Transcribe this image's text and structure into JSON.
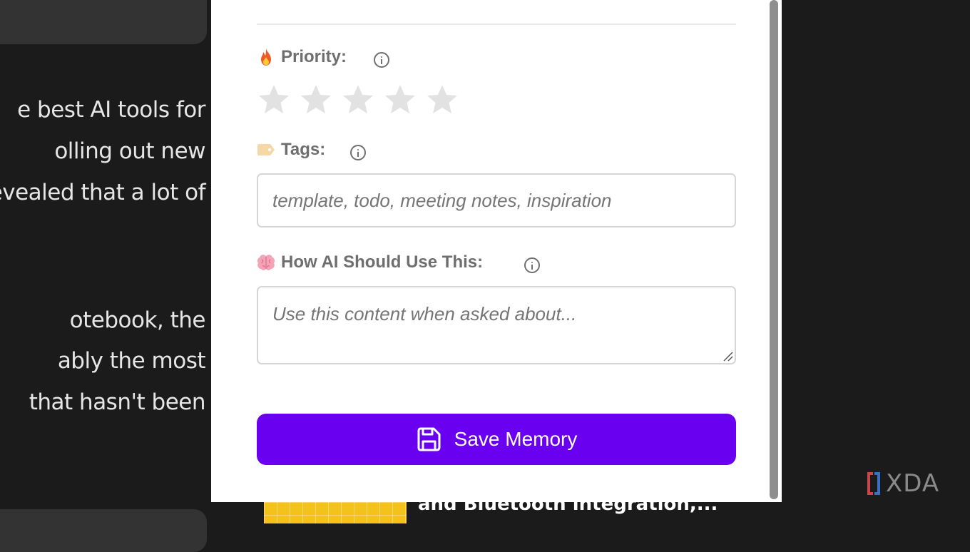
{
  "background_article": {
    "lines_top": [
      "e best AI tools for",
      "olling out new",
      "evealed that a lot of"
    ],
    "lines_bottom": [
      "otebook, the",
      "ably the most",
      "that hasn't been"
    ],
    "related_title": "and Bluetooth integration,...",
    "watermark": "XDA"
  },
  "form": {
    "priority": {
      "emoji": "flame-icon",
      "label": "Priority:",
      "rating": 0,
      "max_rating": 5
    },
    "tags": {
      "emoji": "tag-icon",
      "label": "Tags:",
      "value": "",
      "placeholder": "template, todo, meeting notes, inspiration"
    },
    "ai_usage": {
      "emoji": "brain-icon",
      "label": "How AI Should Use This:",
      "value": "",
      "placeholder": "Use this content when asked about..."
    },
    "save_button": {
      "icon": "floppy-disk-icon",
      "label": "Save Memory"
    }
  },
  "colors": {
    "accent": "#6a00f0",
    "star_empty": "#e2e2e2",
    "label_text": "#6e6e6e",
    "page_background": "#1b1b1b"
  }
}
